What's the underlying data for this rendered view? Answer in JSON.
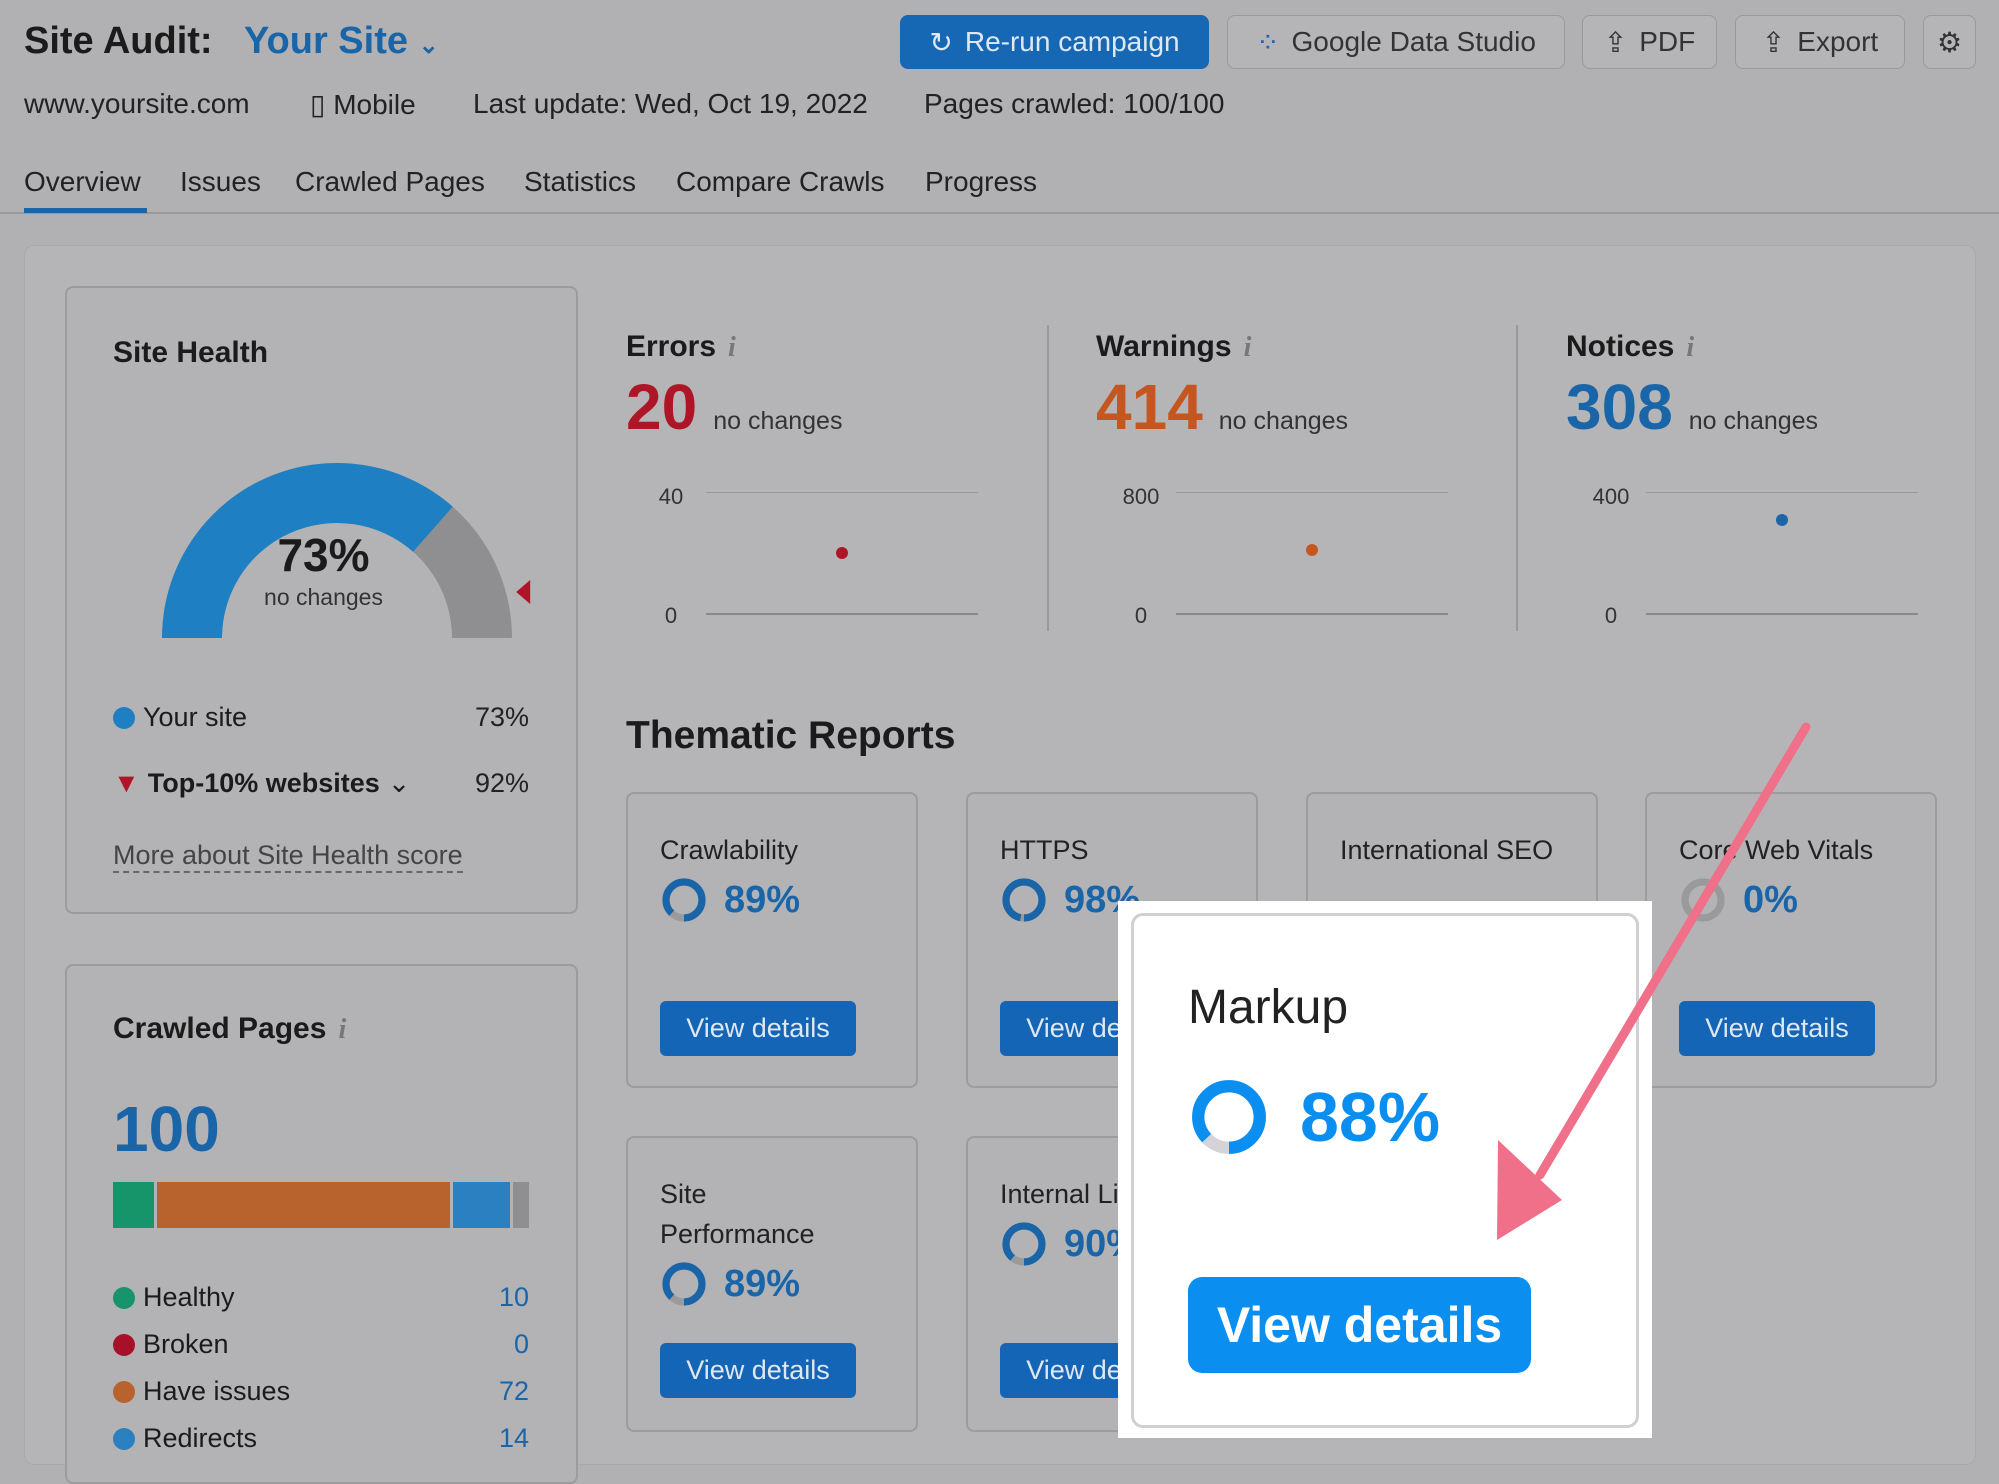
{
  "header": {
    "title": "Site Audit:",
    "project": "Your Site",
    "buttons": {
      "rerun": "Re-run campaign",
      "gds": "Google Data Studio",
      "pdf": "PDF",
      "export": "Export"
    }
  },
  "meta": {
    "domain": "www.yoursite.com",
    "device": "Mobile",
    "last_update": "Last update: Wed, Oct 19, 2022",
    "pages_crawled": "Pages crawled: 100/100"
  },
  "tabs": [
    "Overview",
    "Issues",
    "Crawled Pages",
    "Statistics",
    "Compare Crawls",
    "Progress"
  ],
  "site_health": {
    "title": "Site Health",
    "value": "73%",
    "value_num": 73,
    "change": "no changes",
    "top10_num": 92,
    "legend": [
      {
        "label": "Your site",
        "value": "73%"
      },
      {
        "label": "Top-10% websites",
        "value": "92%"
      }
    ],
    "link": "More about Site Health score"
  },
  "crawled_pages": {
    "title": "Crawled Pages",
    "total": "100",
    "items": [
      {
        "label": "Healthy",
        "value": "10",
        "color": "#16946a"
      },
      {
        "label": "Broken",
        "value": "0",
        "color": "#a8102a"
      },
      {
        "label": "Have issues",
        "value": "72",
        "color": "#b8622e"
      },
      {
        "label": "Redirects",
        "value": "14",
        "color": "#2a80c0"
      }
    ],
    "other": 4
  },
  "metrics": [
    {
      "title": "Errors",
      "value": "20",
      "change": "no changes",
      "ymax": "40",
      "ymin": "0",
      "point": 20,
      "max": 40,
      "color": "#ae1628"
    },
    {
      "title": "Warnings",
      "value": "414",
      "change": "no changes",
      "ymax": "800",
      "ymin": "0",
      "point": 414,
      "max": 800,
      "color": "#c5561f"
    },
    {
      "title": "Notices",
      "value": "308",
      "change": "no changes",
      "ymax": "400",
      "ymin": "0",
      "point": 308,
      "max": 400,
      "color": "#1a65a8"
    }
  ],
  "thematic": {
    "title": "Thematic Reports",
    "view": "View details",
    "reports": [
      {
        "title": "Crawlability",
        "value": "89%",
        "pct": 89
      },
      {
        "title": "HTTPS",
        "value": "98%",
        "pct": 98
      },
      {
        "title": "International SEO",
        "value": "",
        "pct": null
      },
      {
        "title": "Core Web Vitals",
        "value": "0%",
        "pct": 0
      },
      {
        "title": "Site Performance",
        "value": "89%",
        "pct": 89
      },
      {
        "title": "Internal Linking",
        "value": "90%",
        "pct": 90
      }
    ]
  },
  "highlight": {
    "title": "Markup",
    "value": "88%",
    "pct": 88,
    "button": "View details",
    "arrow_color": "#f0708a"
  }
}
